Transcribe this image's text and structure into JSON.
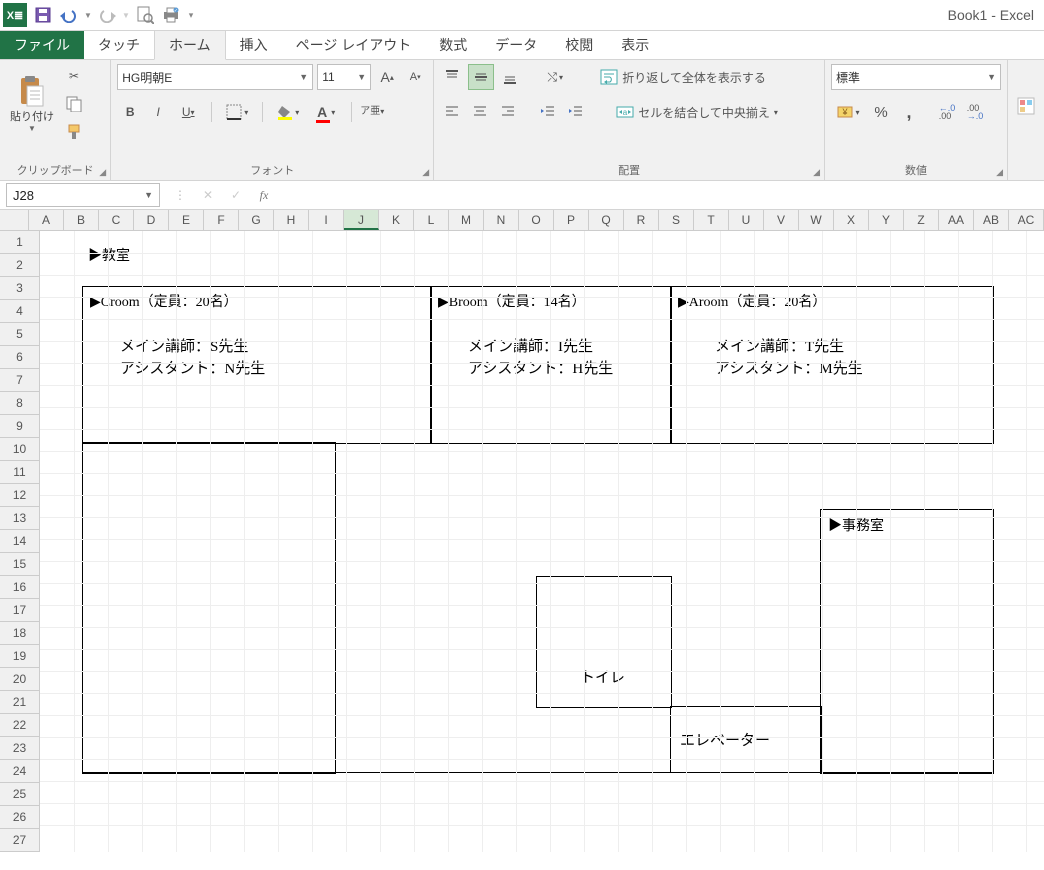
{
  "app": {
    "title": "Book1 - Excel"
  },
  "qat": {
    "save_icon": "save",
    "undo_icon": "undo",
    "redo_icon": "redo",
    "preview_icon": "print-preview",
    "quickprint_icon": "quick-print"
  },
  "tabs": {
    "file": "ファイル",
    "touch": "タッチ",
    "home": "ホーム",
    "insert": "挿入",
    "pagelayout": "ページ レイアウト",
    "formulas": "数式",
    "data": "データ",
    "review": "校閲",
    "view": "表示"
  },
  "ribbon": {
    "clipboard": {
      "label": "クリップボード",
      "paste": "貼り付け"
    },
    "font": {
      "label": "フォント",
      "name": "HG明朝E",
      "size": "11",
      "ruby": "ア亜"
    },
    "alignment": {
      "label": "配置",
      "wrap": "折り返して全体を表示する",
      "merge": "セルを結合して中央揃え"
    },
    "number": {
      "label": "数値",
      "format": "標準"
    }
  },
  "formula_bar": {
    "cell_ref": "J28",
    "fx": "fx",
    "value": ""
  },
  "columns": [
    "A",
    "B",
    "C",
    "D",
    "E",
    "F",
    "G",
    "H",
    "I",
    "J",
    "K",
    "L",
    "M",
    "N",
    "O",
    "P",
    "Q",
    "R",
    "S",
    "T",
    "U",
    "V",
    "W",
    "X",
    "Y",
    "Z",
    "AA",
    "AB",
    "AC"
  ],
  "row_count": 27,
  "selection": {
    "col_index": 9,
    "row_index": 27
  },
  "plan": {
    "title": "▶教室",
    "rooms": {
      "c": {
        "name": "▶Croom（定員：20名）",
        "teacher": "メイン講師：S先生",
        "assistant": "アシスタント：N先生"
      },
      "b": {
        "name": "▶Broom（定員：14名）",
        "teacher": "メイン講師：I先生",
        "assistant": "アシスタント：H先生"
      },
      "a": {
        "name": "▶Aroom（定員：20名）",
        "teacher": "メイン講師：T先生",
        "assistant": "アシスタント：M先生"
      }
    },
    "office": "▶事務室",
    "toilet": "トイレ",
    "elevator": "エレベーター"
  }
}
